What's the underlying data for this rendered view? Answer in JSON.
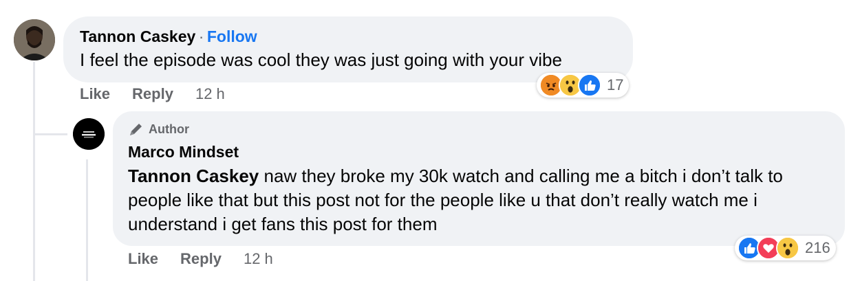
{
  "comment1": {
    "author": "Tannon Caskey",
    "separator": "·",
    "follow_label": "Follow",
    "text": "I feel the episode was cool they was just going with your vibe",
    "actions": {
      "like": "Like",
      "reply": "Reply",
      "time": "12 h"
    },
    "reactions": {
      "icons": [
        "angry-icon",
        "wow-icon",
        "like-icon"
      ],
      "count": "17"
    }
  },
  "comment2": {
    "badge": "Author",
    "author": "Marco Mindset",
    "mention": "Tannon Caskey",
    "text": "naw they broke my 30k watch and calling me a bitch i don’t talk to people like that but this post not for the people like u that don’t really watch me i understand i get fans this post for them",
    "actions": {
      "like": "Like",
      "reply": "Reply",
      "time": "12 h"
    },
    "reactions": {
      "icons": [
        "like-icon",
        "love-icon",
        "wow-icon"
      ],
      "count": "216"
    }
  },
  "colors": {
    "bubble": "#f0f2f5",
    "link": "#1877f2",
    "meta": "#65676b",
    "like_blue": "#1877f2",
    "love_red": "#f33e58",
    "wow_yellow": "#f7b125",
    "angry_orange": "#e9710f"
  }
}
